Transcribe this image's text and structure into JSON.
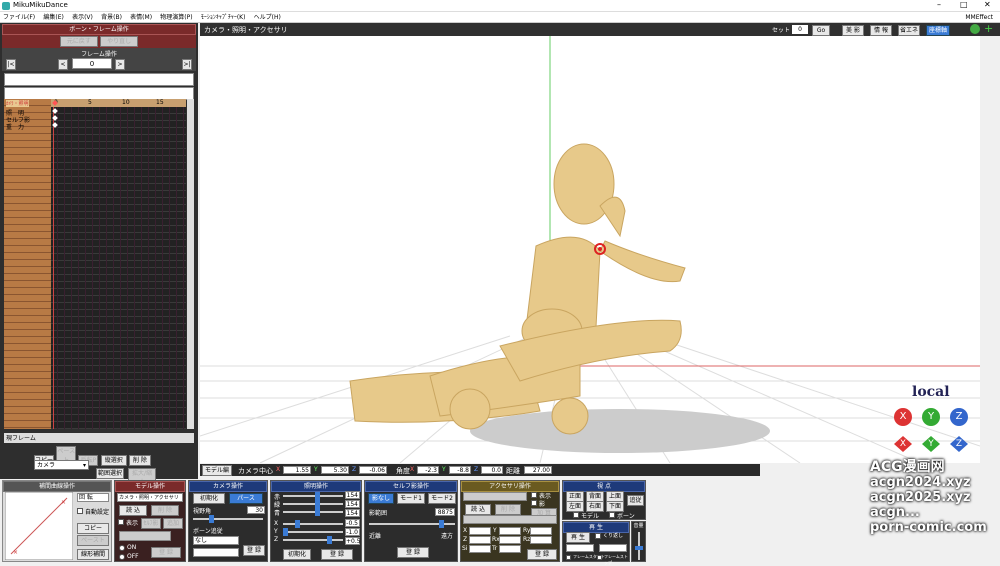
{
  "app_title": "MikuMikuDance",
  "window_controls": {
    "minimize": "–",
    "maximize": "□",
    "close": "✕"
  },
  "menu": [
    "ファイル(F)",
    "編集(E)",
    "表示(V)",
    "背景(B)",
    "表情(M)",
    "物理演算(P)",
    "ﾓｰｼｮﾝｷｬﾌﾟﾁｬｰ(K)",
    "ヘルプ(H)"
  ],
  "mmeffect": "MMEffect",
  "bone_frame": {
    "title": "ボーン・フレーム操作",
    "undo": "元に戻す",
    "redo": "やり直し",
    "frame_title": "フレーム操作",
    "frame_value": "0",
    "nav": [
      "|<",
      "<",
      ">",
      ">|"
    ]
  },
  "timeline": {
    "ruler": [
      "0",
      "5",
      "10",
      "15"
    ],
    "tracks": [
      "ｶﾒﾗ・照明",
      "照　明",
      "セルフ影",
      "重　力"
    ],
    "current_frame_label": "現フレーム"
  },
  "edit_buttons": [
    "コピー",
    "ペースト",
    "反転P",
    "縦選択",
    "削 除"
  ],
  "camera_select": "カメラ",
  "range_buttons": [
    "範囲選択",
    "拡大/縮小"
  ],
  "viewport": {
    "header": "カメラ・照明・アクセサリ",
    "set_label": "セット",
    "set_value": "0",
    "go": "Go",
    "buttons": [
      "美 影",
      "情 報",
      "省エネ",
      "座標軸"
    ],
    "local": "local",
    "axis_icons": [
      "X",
      "Y",
      "Z"
    ],
    "watermark": [
      "ACG漫画网",
      "acgn2024.xyz",
      "acgn2025.xyz",
      "acgn...",
      "porn-comic.com"
    ]
  },
  "bottom_bar": {
    "tab": "モデル編",
    "camera_center_label": "カメラ中心",
    "x": "1.55",
    "y": "5.30",
    "z": "-0.06",
    "angle_label": "角度",
    "ax": "-2.3",
    "ay": "-8.8",
    "az": "0.0",
    "distance_label": "距離",
    "distance": "27.00"
  },
  "interp": {
    "title": "補間曲線操作",
    "rotate": "回 転",
    "auto": "自動設定",
    "copy": "コピー",
    "paste": "ペースト",
    "linear": "線形補間"
  },
  "model_op": {
    "title": "モデル操作",
    "select": "カメラ・照明・アクセサリ",
    "load": "読 込",
    "delete": "削 除",
    "display": "表示",
    "select_btn": "ｾﾙﾌ影",
    "add": "追加",
    "register": "登 録",
    "on": "ON",
    "off": "OFF"
  },
  "camera_op": {
    "title": "カメラ操作",
    "init": "初期化",
    "perspective": "パース",
    "fov_label": "視野角",
    "fov": "30",
    "bone_follow": "ボーン追従",
    "none": "なし",
    "register": "登 録"
  },
  "light_op": {
    "title": "照明操作",
    "labels": [
      "赤",
      "緑",
      "青",
      "X",
      "Y",
      "Z"
    ],
    "values": [
      "154",
      "154",
      "154",
      "-0.5",
      "-1.0",
      "+0.5"
    ],
    "init": "初期化",
    "register": "登 録"
  },
  "shadow_op": {
    "title": "セルフ影操作",
    "none": "影なし",
    "mode1": "モード1",
    "mode2": "モード2",
    "range_label": "影範囲",
    "range": "8875",
    "near": "近離",
    "far": "遠方",
    "register": "登 録"
  },
  "acc_op": {
    "title": "アクセサリ操作",
    "display": "表示",
    "shadow": "影",
    "load": "読 込",
    "delete": "削 除",
    "add": "加 算",
    "labels": [
      "X",
      "Y",
      "Z",
      "Rx",
      "Ry",
      "Rz",
      "Si",
      "Tr"
    ],
    "register": "登 録"
  },
  "view_op": {
    "title": "視 点",
    "buttons": [
      "正面",
      "背面",
      "上面",
      "左面",
      "右面",
      "下面"
    ],
    "track": "追従",
    "model": "モデル",
    "bone": "ボーン"
  },
  "play_op": {
    "title": "再 生",
    "play": "再 生",
    "loop": "くり返し",
    "from": "フレームスタート",
    "to": "フレームストップ"
  },
  "volume": {
    "title": "音量"
  },
  "colors": {
    "accent": "#3a7bd5",
    "viewport_bg": "#ffffff",
    "mannequin": "#e7c98a",
    "dark_panel": "#2c2c2c"
  }
}
